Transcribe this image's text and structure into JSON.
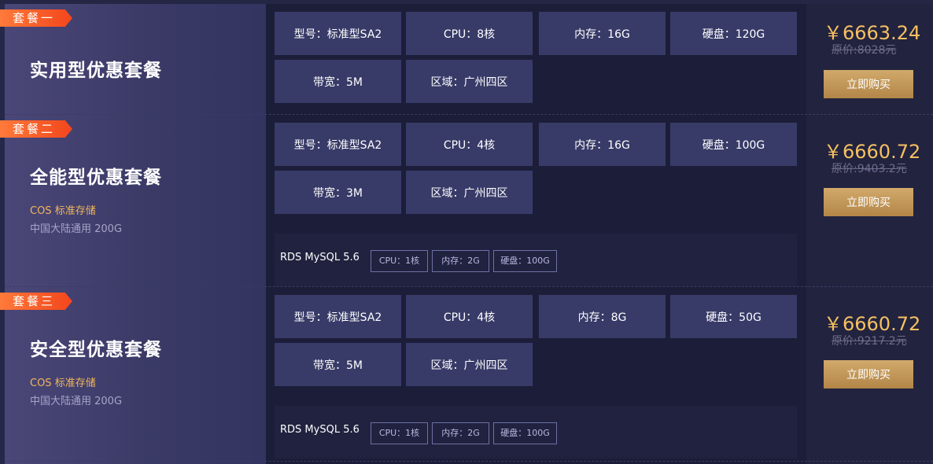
{
  "plans": [
    {
      "badge": "套餐一",
      "title": "实用型优惠套餐",
      "specs": [
        "型号：标准型SA2",
        "CPU：8核",
        "内存：16G",
        "硬盘：120G",
        "带宽：5M",
        "区域：广州四区"
      ],
      "price": "￥6663.24",
      "original_price": "原价:8028元",
      "buy_label": "立即购买"
    },
    {
      "badge": "套餐二",
      "title": "全能型优惠套餐",
      "cos_title": "COS 标准存储",
      "cos_desc": "中国大陆通用 200G",
      "specs": [
        "型号：标准型SA2",
        "CPU：4核",
        "内存：16G",
        "硬盘：100G",
        "带宽：3M",
        "区域：广州四区"
      ],
      "rds": {
        "label": "RDS MySQL 5.6",
        "tags": [
          "CPU：1核",
          "内存：2G",
          "硬盘：100G"
        ]
      },
      "price": "￥6660.72",
      "original_price": "原价:9403.2元",
      "buy_label": "立即购买"
    },
    {
      "badge": "套餐三",
      "title": "安全型优惠套餐",
      "cos_title": "COS 标准存储",
      "cos_desc": "中国大陆通用 200G",
      "specs": [
        "型号：标准型SA2",
        "CPU：4核",
        "内存：8G",
        "硬盘：50G",
        "带宽：5M",
        "区域：广州四区"
      ],
      "rds": {
        "label": "RDS MySQL 5.6",
        "tags": [
          "CPU：1核",
          "内存：2G",
          "硬盘：100G"
        ]
      },
      "price": "￥6660.72",
      "original_price": "原价:9217.2元",
      "buy_label": "立即购买"
    }
  ],
  "colors": {
    "accent_gold": "#f6c062",
    "ribbon": "#f2461c",
    "cos_orange": "#f2b65c"
  }
}
